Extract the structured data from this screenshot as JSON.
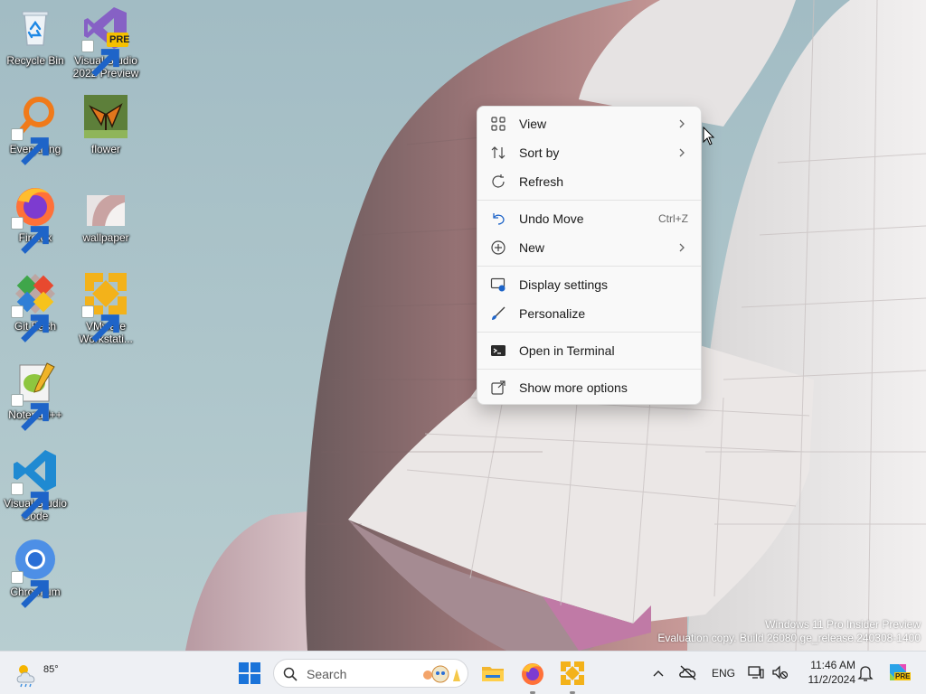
{
  "desktop": {
    "icons": [
      {
        "label": "Recycle Bin",
        "icon": "recycle-bin-icon"
      },
      {
        "label": "Visual Studio 2022 Preview",
        "badge": "PRE",
        "icon": "visual-studio-icon"
      },
      {
        "label": "Everything",
        "icon": "everything-search-icon"
      },
      {
        "label": "flower",
        "icon": "image-file-icon"
      },
      {
        "label": "Firefox",
        "icon": "firefox-icon"
      },
      {
        "label": "wallpaper",
        "icon": "image-file-icon"
      },
      {
        "label": "Git Bash",
        "icon": "git-bash-icon"
      },
      {
        "label": "VMware Workstati...",
        "icon": "vmware-icon"
      },
      {
        "label": "Notepad++",
        "icon": "notepad-plus-plus-icon"
      },
      {
        "label": "Visual Studio Code",
        "icon": "vscode-icon"
      },
      {
        "label": "Chromium",
        "icon": "chromium-icon"
      }
    ]
  },
  "context_menu": {
    "items": [
      {
        "label": "View",
        "icon": "grid-icon",
        "submenu": true
      },
      {
        "label": "Sort by",
        "icon": "sort-icon",
        "submenu": true
      },
      {
        "label": "Refresh",
        "icon": "refresh-icon"
      },
      {
        "label": "Undo Move",
        "icon": "undo-icon",
        "shortcut": "Ctrl+Z"
      },
      {
        "label": "New",
        "icon": "plus-circle-icon",
        "submenu": true
      },
      {
        "label": "Display settings",
        "icon": "display-settings-icon"
      },
      {
        "label": "Personalize",
        "icon": "brush-icon"
      },
      {
        "label": "Open in Terminal",
        "icon": "terminal-icon"
      },
      {
        "label": "Show more options",
        "icon": "open-external-icon"
      }
    ]
  },
  "watermark": {
    "line1": "Windows 11 Pro Insider Preview",
    "line2": "Evaluation copy. Build 26080.ge_release.240308-1400"
  },
  "taskbar": {
    "weather_temp": "85°",
    "search_placeholder": "Search",
    "language": "ENG",
    "clock_time": "11:46 AM",
    "clock_date": "11/2/2024",
    "copilot_badge": "PRE"
  },
  "colors": {
    "accent": "#0067c0",
    "menu_background": "#f9f9f9",
    "taskbar_background": "#eef0f4"
  }
}
